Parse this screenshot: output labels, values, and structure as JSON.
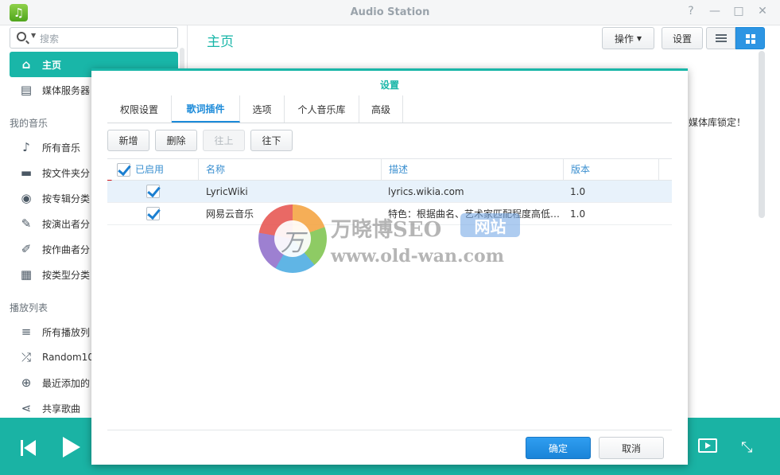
{
  "window": {
    "title": "Audio Station",
    "controls": [
      "?",
      "—",
      "□",
      "✕"
    ]
  },
  "sidebar": {
    "search_placeholder": "搜索",
    "items_top": [
      {
        "label": "主页",
        "icon": "home-icon",
        "active": true
      },
      {
        "label": "媒体服务器",
        "icon": "media-server-icon"
      }
    ],
    "section_music": "我的音乐",
    "music_items": [
      {
        "label": "所有音乐",
        "icon": "music-note-icon"
      },
      {
        "label": "按文件夹分",
        "icon": "folder-icon"
      },
      {
        "label": "按专辑分类",
        "icon": "album-icon"
      },
      {
        "label": "按演出者分",
        "icon": "microphone-icon"
      },
      {
        "label": "按作曲者分",
        "icon": "pen-icon"
      },
      {
        "label": "按类型分类",
        "icon": "grid-icon"
      }
    ],
    "section_playlist": "播放列表",
    "playlist_items": [
      {
        "label": "所有播放列",
        "icon": "playlist-icon"
      },
      {
        "label": "Random10",
        "icon": "shuffle-icon"
      },
      {
        "label": "最近添加的",
        "icon": "plus-circle-icon"
      },
      {
        "label": "共享歌曲",
        "icon": "share-icon"
      }
    ]
  },
  "main": {
    "title": "主页",
    "action_label": "操作",
    "settings_label": "设置",
    "partial_text": "，媒体库锁定！"
  },
  "dialog": {
    "title": "设置",
    "tabs": [
      {
        "label": "权限设置",
        "active": false
      },
      {
        "label": "歌词插件",
        "active": true
      },
      {
        "label": "选项",
        "active": false
      },
      {
        "label": "个人音乐库",
        "active": false
      },
      {
        "label": "高级",
        "active": false
      }
    ],
    "buttons": {
      "add": "新增",
      "delete": "删除",
      "up": "往上",
      "down": "往下"
    },
    "columns": {
      "enabled": "已启用",
      "name": "名称",
      "description": "描述",
      "version": "版本"
    },
    "rows": [
      {
        "enabled": true,
        "name": "LyricWiki",
        "description": "lyrics.wikia.com",
        "version": "1.0"
      },
      {
        "enabled": true,
        "name": "网易云音乐",
        "description": "特色：根据曲名、艺术家匹配程度高低…",
        "version": "1.0"
      }
    ],
    "ok_label": "确定",
    "cancel_label": "取消"
  },
  "watermark": {
    "logo_glyph": "万",
    "title": "万晓博SEO",
    "badge": "网站",
    "url": "www.old-wan.com"
  },
  "colors": {
    "accent": "#19b6a8",
    "primary_button": "#1b8ad9",
    "checkbox": "#1b7fd1"
  }
}
